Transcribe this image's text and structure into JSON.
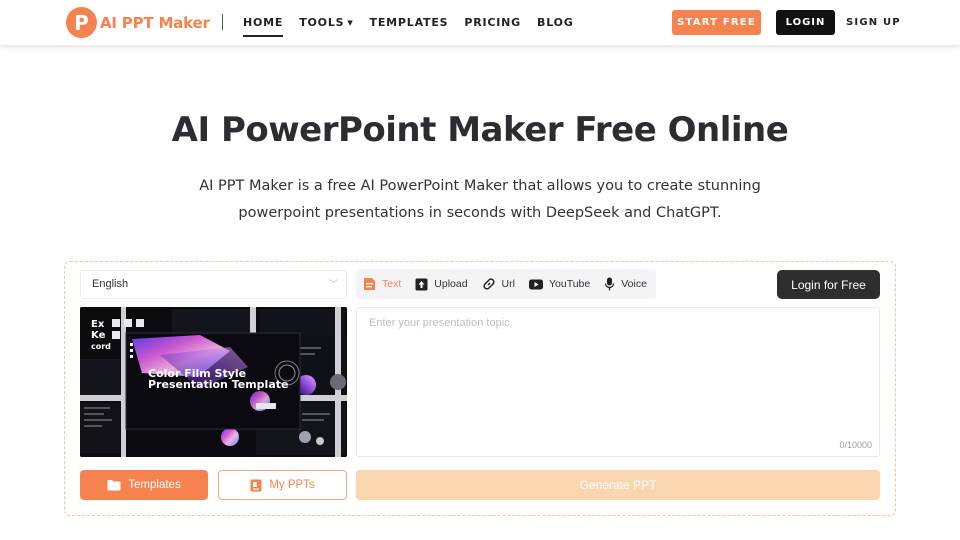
{
  "brand": {
    "mark": "P",
    "name": "AI PPT Maker",
    "color": "#f5824f"
  },
  "nav": {
    "links": [
      {
        "label": "HOME",
        "active": true
      },
      {
        "label": "TOOLS",
        "has_dropdown": true
      },
      {
        "label": "TEMPLATES"
      },
      {
        "label": "PRICING"
      },
      {
        "label": "BLOG"
      }
    ],
    "start_label": "START FREE",
    "login_label": "LOGIN",
    "signup_label": "SIGN UP"
  },
  "hero": {
    "title": "AI PowerPoint Maker Free Online",
    "subtitle": "AI PPT Maker is a free AI PowerPoint Maker that allows you to create stunning powerpoint presentations in seconds with DeepSeek and ChatGPT."
  },
  "tool": {
    "language": "English",
    "preview": {
      "headline_line1": "Color Film Style",
      "headline_line2": "Presentation Template",
      "corner_text": [
        "Ex",
        "Ke",
        "cord"
      ]
    },
    "tabs": [
      {
        "label": "Text",
        "icon": "text-doc-icon",
        "active": true
      },
      {
        "label": "Upload",
        "icon": "upload-icon"
      },
      {
        "label": "Url",
        "icon": "link-icon"
      },
      {
        "label": "YouTube",
        "icon": "youtube-icon"
      },
      {
        "label": "Voice",
        "icon": "microphone-icon"
      }
    ],
    "login_free_label": "Login for Free",
    "topic_placeholder": "Enter your presentation topic",
    "char_counter": "0/10000",
    "templates_label": "Templates",
    "myppts_label": "My PPTs",
    "generate_label": "Generate PPT"
  }
}
